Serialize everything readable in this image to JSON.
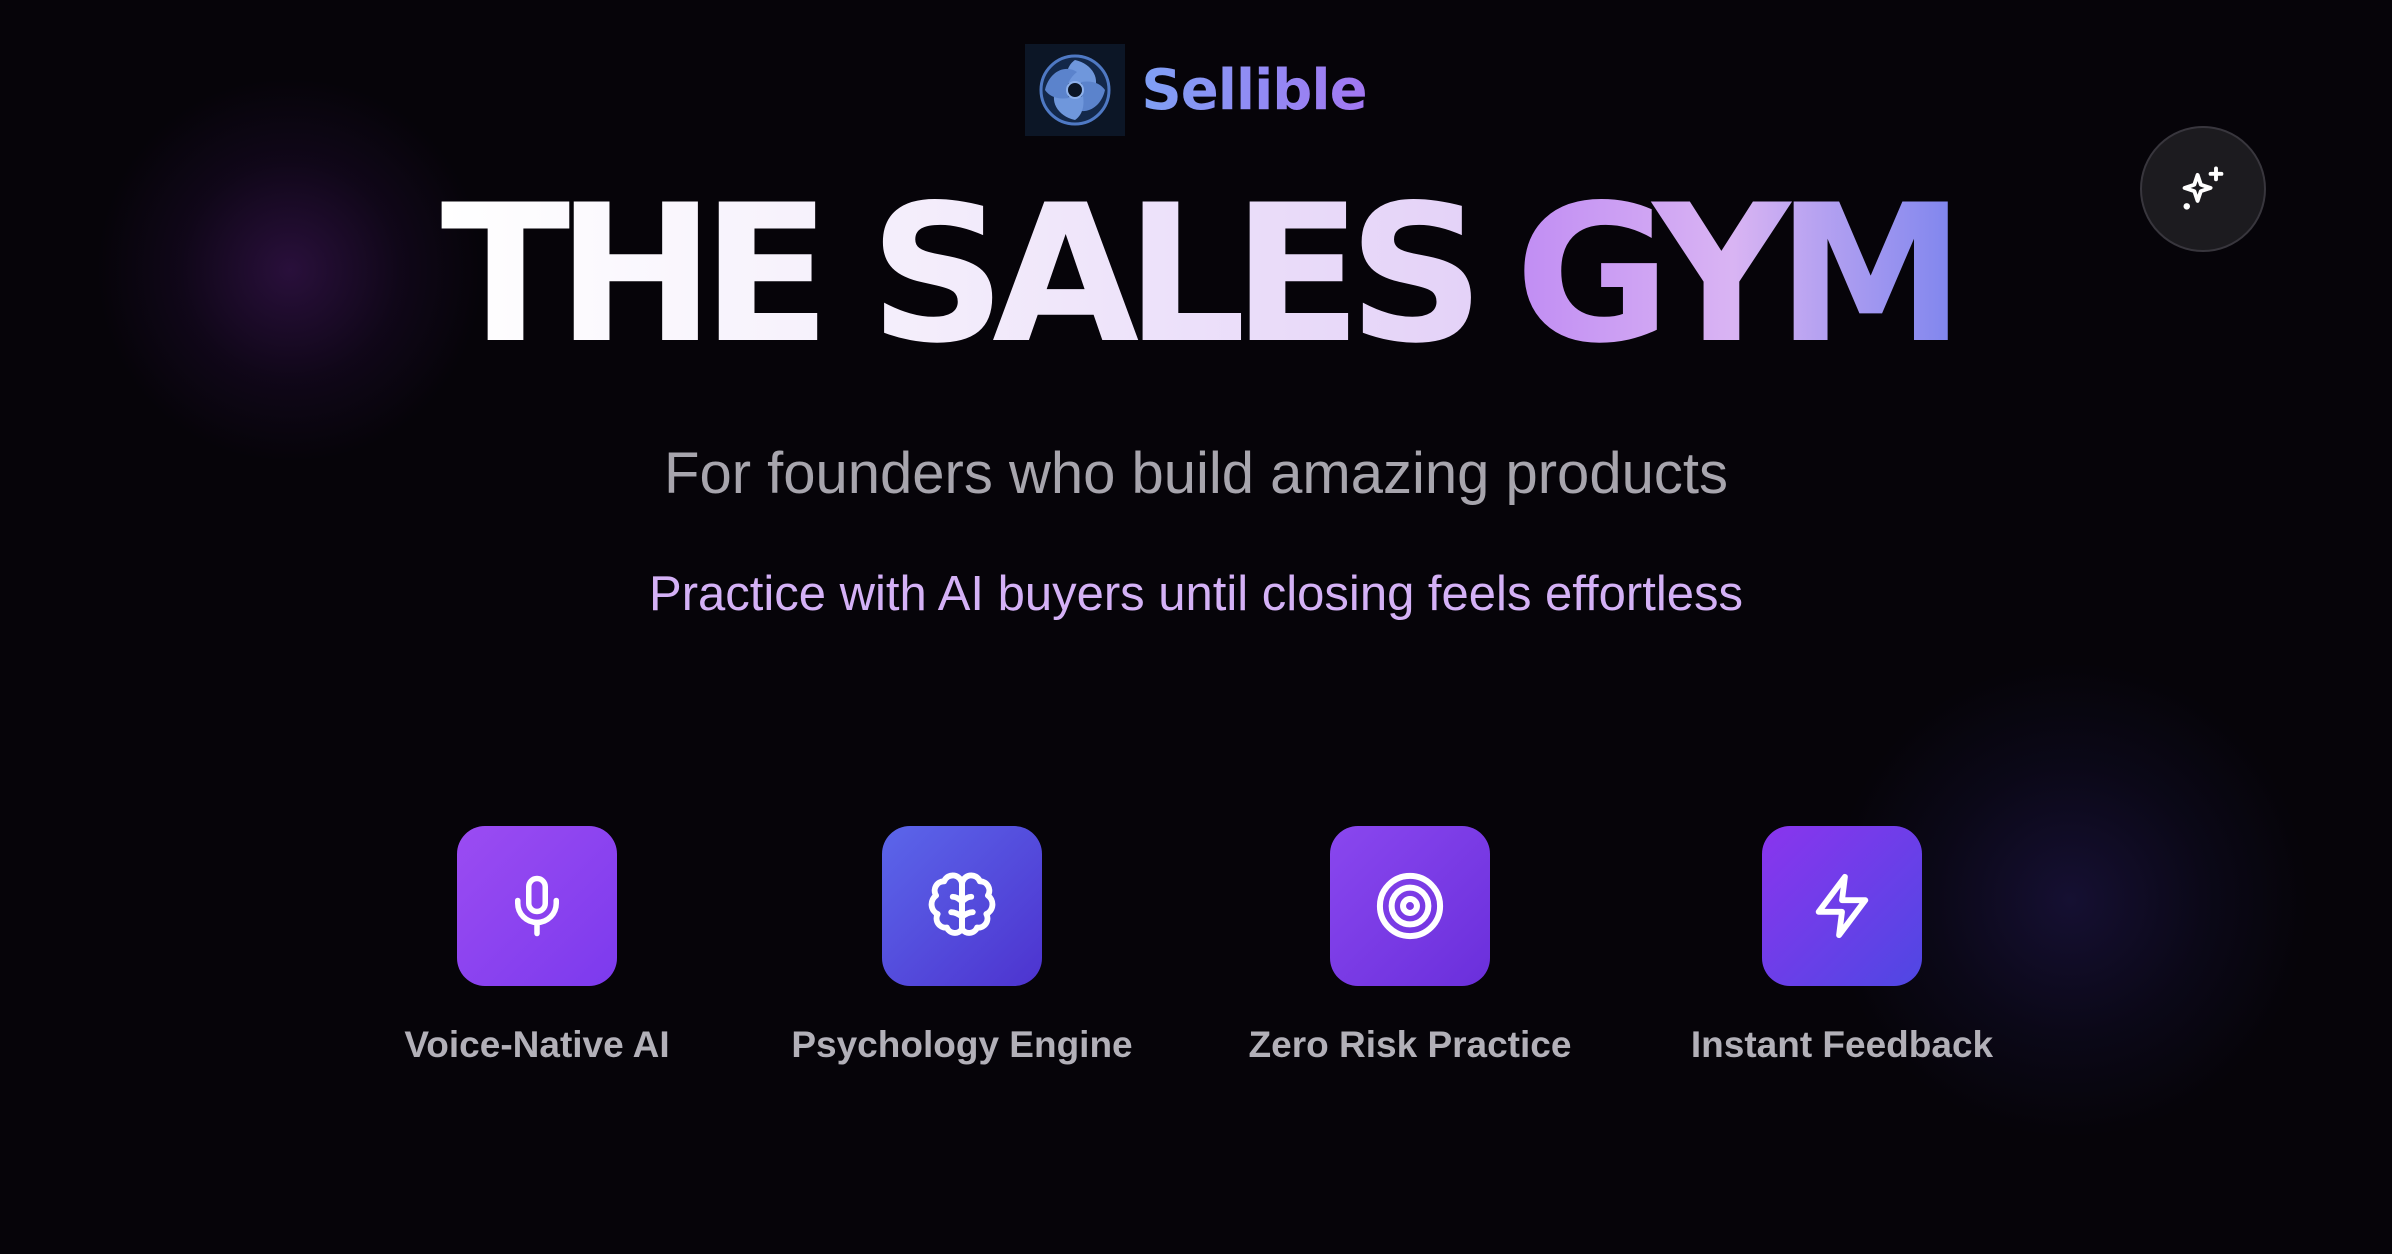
{
  "brand": {
    "name": "Sellible",
    "logo_icon": "sellible-logo-icon"
  },
  "hero": {
    "headline_main": "THE SALES",
    "headline_accent": "GYM",
    "subtitle": "For founders who build amazing products",
    "tagline": "Practice with AI buyers until closing feels effortless"
  },
  "sparkle_button": {
    "icon": "sparkles-icon"
  },
  "features": [
    {
      "label": "Voice-Native AI",
      "icon": "microphone-icon"
    },
    {
      "label": "Psychology Engine",
      "icon": "brain-icon"
    },
    {
      "label": "Zero Risk Practice",
      "icon": "target-icon"
    },
    {
      "label": "Instant Feedback",
      "icon": "lightning-icon"
    }
  ],
  "colors": {
    "background": "#060409",
    "brand_gradient_start": "#7fa0f5",
    "brand_gradient_end": "#a277f2",
    "tagline": "#d4b1f6",
    "subtitle": "#a7a5ad",
    "tile_violet": "#8b3ff0",
    "tile_indigo": "#5560e8"
  }
}
